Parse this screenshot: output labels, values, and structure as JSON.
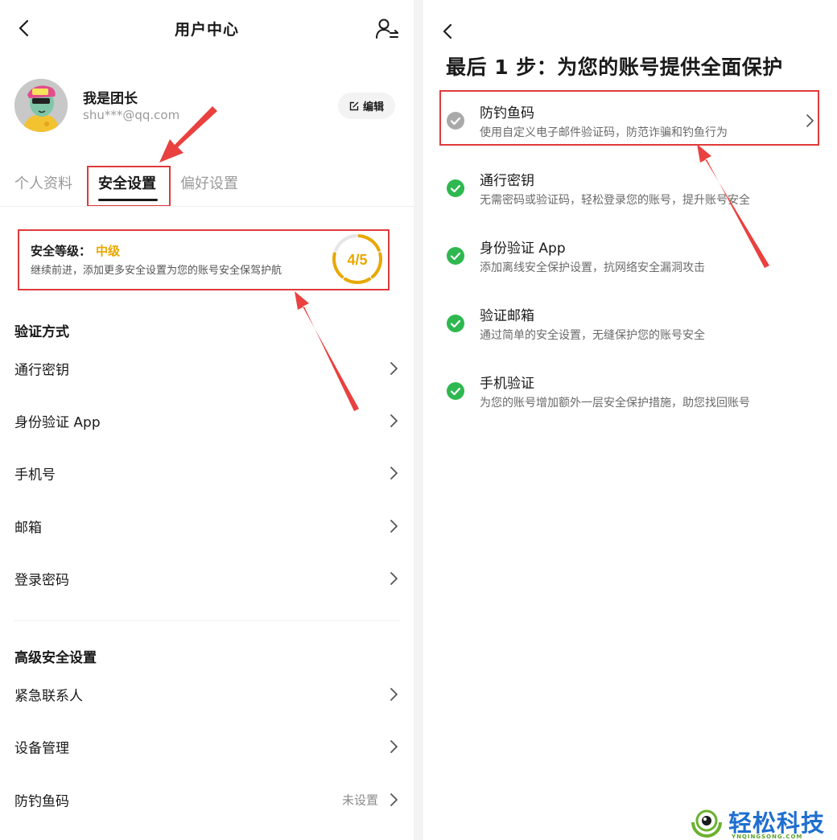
{
  "left": {
    "header": {
      "title": "用户中心"
    },
    "profile": {
      "name": "我是团长",
      "email": "shu***@qq.com",
      "edit_label": "编辑"
    },
    "tabs": [
      {
        "label": "个人资料",
        "active": false
      },
      {
        "label": "安全设置",
        "active": true
      },
      {
        "label": "偏好设置",
        "active": false
      }
    ],
    "security": {
      "title": "安全等级：",
      "level": "中级",
      "description": "继续前进，添加更多安全设置为您的账号安全保驾护航",
      "score": "4/5",
      "progress": 0.8,
      "color": "#e9a800"
    },
    "verification": {
      "title": "验证方式",
      "items": [
        {
          "label": "通行密钥"
        },
        {
          "label": "身份验证 App"
        },
        {
          "label": "手机号"
        },
        {
          "label": "邮箱"
        },
        {
          "label": "登录密码"
        }
      ]
    },
    "advanced": {
      "title": "高级安全设置",
      "items": [
        {
          "label": "紧急联系人",
          "value": ""
        },
        {
          "label": "设备管理",
          "value": ""
        },
        {
          "label": "防钓鱼码",
          "value": "未设置"
        }
      ]
    }
  },
  "right": {
    "title": "最后 1 步：为您的账号提供全面保护",
    "items": [
      {
        "title": "防钓鱼码",
        "description": "使用自定义电子邮件验证码，防范诈骗和钓鱼行为",
        "done": false
      },
      {
        "title": "通行密钥",
        "description": "无需密码或验证码，轻松登录您的账号，提升账号安全",
        "done": true
      },
      {
        "title": "身份验证 App",
        "description": "添加离线安全保护设置，抗网络安全漏洞攻击",
        "done": true
      },
      {
        "title": "验证邮箱",
        "description": "通过简单的安全设置，无缝保护您的账号安全",
        "done": true
      },
      {
        "title": "手机验证",
        "description": "为您的账号增加额外一层安全保护措施，助您找回账号",
        "done": true
      }
    ]
  },
  "watermark": {
    "name": "轻松科技",
    "domain": "YNQINGSONG.COM"
  },
  "colors": {
    "accent": "#e9a800",
    "success": "#2eb84f",
    "annotation": "#e03a3a",
    "pending": "#a9a9a9"
  }
}
